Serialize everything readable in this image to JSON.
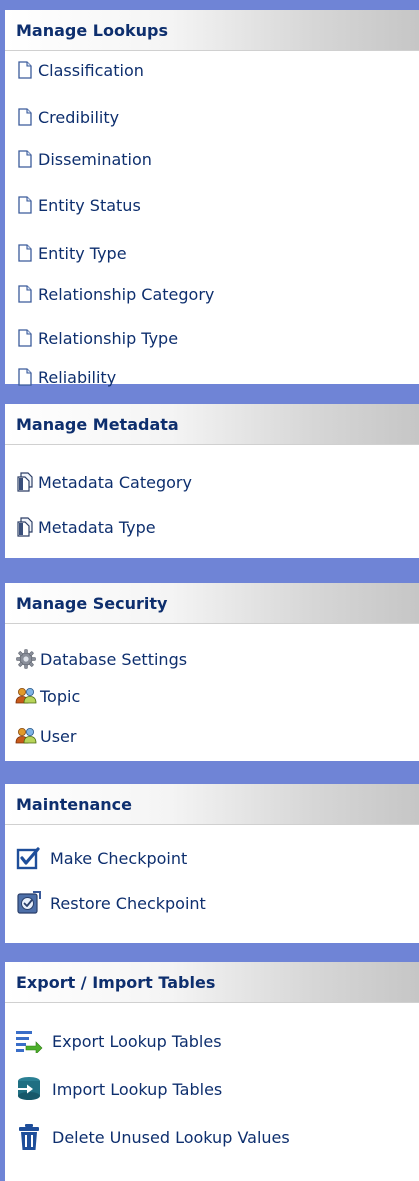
{
  "sections": [
    {
      "title": "Manage Lookups",
      "items": [
        {
          "label": "Classification",
          "icon": "document-icon"
        },
        {
          "label": "Credibility",
          "icon": "document-icon"
        },
        {
          "label": "Dissemination",
          "icon": "document-icon"
        },
        {
          "label": "Entity Status",
          "icon": "document-icon"
        },
        {
          "label": "Entity Type",
          "icon": "document-icon"
        },
        {
          "label": "Relationship Category",
          "icon": "document-icon"
        },
        {
          "label": "Relationship Type",
          "icon": "document-icon"
        },
        {
          "label": "Reliability",
          "icon": "document-icon"
        }
      ]
    },
    {
      "title": "Manage Metadata",
      "items": [
        {
          "label": "Metadata Category",
          "icon": "documents-icon"
        },
        {
          "label": "Metadata Type",
          "icon": "documents-icon"
        }
      ]
    },
    {
      "title": "Manage Security",
      "items": [
        {
          "label": "Database Settings",
          "icon": "gear-icon"
        },
        {
          "label": "Topic",
          "icon": "users-icon"
        },
        {
          "label": "User",
          "icon": "users-icon"
        }
      ]
    },
    {
      "title": "Maintenance",
      "items": [
        {
          "label": "Make Checkpoint",
          "icon": "checkbox-icon"
        },
        {
          "label": "Restore Checkpoint",
          "icon": "restore-checkpoint-icon"
        }
      ]
    },
    {
      "title": "Export / Import Tables",
      "items": [
        {
          "label": "Export Lookup Tables",
          "icon": "export-icon"
        },
        {
          "label": "Import Lookup Tables",
          "icon": "import-icon"
        },
        {
          "label": "Delete Unused Lookup Values",
          "icon": "trash-icon"
        }
      ]
    }
  ],
  "colors": {
    "background": "#6f84d6",
    "text": "#0e2f6e",
    "panel": "#ffffff"
  }
}
